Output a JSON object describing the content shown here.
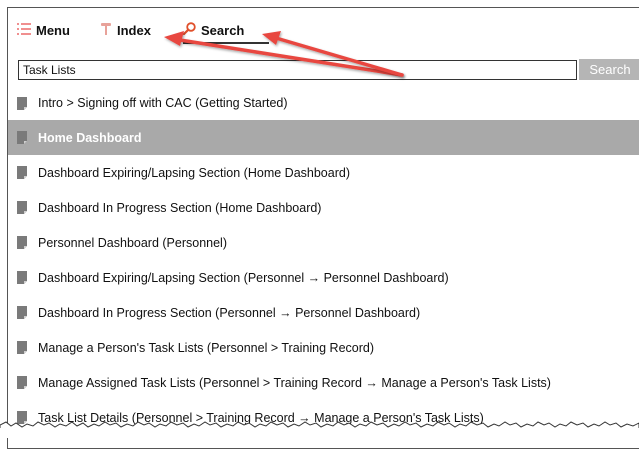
{
  "tabs": {
    "menu": {
      "label": "Menu",
      "icon": "menu-list-icon"
    },
    "index": {
      "label": "Index",
      "icon": "pushpin-icon"
    },
    "search": {
      "label": "Search",
      "icon": "magnifier-icon"
    }
  },
  "search": {
    "value": "Task Lists",
    "button_label": "Search"
  },
  "results": [
    {
      "label": "Intro > Signing off with CAC (Getting Started)",
      "selected": false
    },
    {
      "label": "Home Dashboard",
      "selected": true
    },
    {
      "label": "Dashboard Expiring/Lapsing Section (Home Dashboard)",
      "selected": false
    },
    {
      "label": "Dashboard In Progress Section (Home Dashboard)",
      "selected": false
    },
    {
      "label": "Personnel Dashboard (Personnel)",
      "selected": false
    },
    {
      "label": "Dashboard Expiring/Lapsing Section (Personnel → Personnel Dashboard)",
      "selected": false
    },
    {
      "label": "Dashboard In Progress Section (Personnel → Personnel Dashboard)",
      "selected": false
    },
    {
      "label": "Manage a Person's Task Lists (Personnel > Training Record)",
      "selected": false
    },
    {
      "label": "Manage Assigned Task Lists (Personnel > Training Record → Manage a Person's Task Lists)",
      "selected": false
    },
    {
      "label": "Task List Details (Personnel > Training Record → Manage a Person's Task Lists)",
      "selected": false
    }
  ],
  "colors": {
    "selected_row": "#a9a9a9",
    "annotation_arrow": "#e8463f",
    "menu_icon": "#f08f8f",
    "pin_icon": "#e8a29a",
    "search_icon": "#e0502b",
    "page_icon": "#7a7a7a",
    "button_bg": "#b5b5b5"
  }
}
